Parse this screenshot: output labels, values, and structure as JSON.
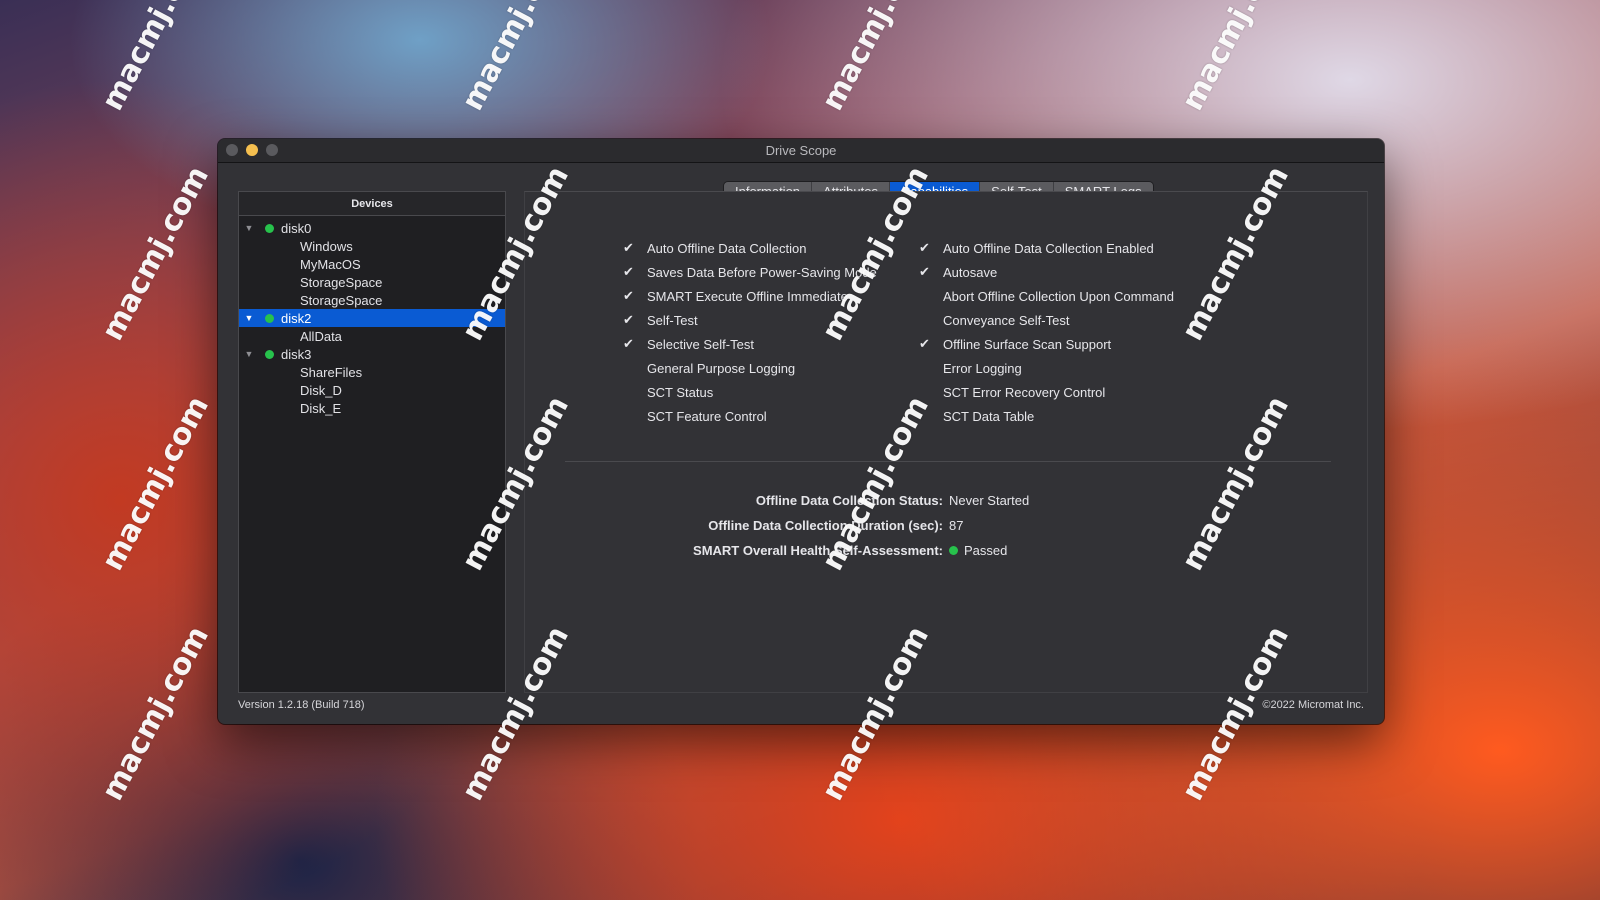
{
  "window": {
    "title": "Drive Scope",
    "traffic_lights": [
      "close",
      "minimize",
      "maximize"
    ]
  },
  "sidebar": {
    "header": "Devices",
    "items": [
      {
        "label": "disk0",
        "level": 0,
        "expanded": true,
        "status_color": "#27c24c",
        "selected": false
      },
      {
        "label": "Windows",
        "level": 1
      },
      {
        "label": "MyMacOS",
        "level": 1
      },
      {
        "label": "StorageSpace",
        "level": 1
      },
      {
        "label": "StorageSpace",
        "level": 1
      },
      {
        "label": "disk2",
        "level": 0,
        "expanded": true,
        "status_color": "#27c24c",
        "selected": true
      },
      {
        "label": "AllData",
        "level": 1
      },
      {
        "label": "disk3",
        "level": 0,
        "expanded": true,
        "status_color": "#27c24c",
        "selected": false
      },
      {
        "label": "ShareFiles",
        "level": 1
      },
      {
        "label": "Disk_D",
        "level": 1
      },
      {
        "label": "Disk_E",
        "level": 1
      }
    ]
  },
  "tabs": [
    {
      "label": "Information",
      "active": false
    },
    {
      "label": "Attributes",
      "active": false
    },
    {
      "label": "Capabilities",
      "active": true
    },
    {
      "label": "Self-Test",
      "active": false
    },
    {
      "label": "SMART Logs",
      "active": false
    }
  ],
  "capabilities": {
    "left": [
      {
        "label": "Auto Offline Data Collection",
        "checked": true
      },
      {
        "label": "Saves Data Before Power-Saving Mode",
        "checked": true
      },
      {
        "label": "SMART Execute Offline Immediate",
        "checked": true
      },
      {
        "label": "Self-Test",
        "checked": true
      },
      {
        "label": "Selective Self-Test",
        "checked": true
      },
      {
        "label": "General Purpose Logging",
        "checked": false
      },
      {
        "label": "SCT Status",
        "checked": false
      },
      {
        "label": "SCT Feature Control",
        "checked": false
      }
    ],
    "right": [
      {
        "label": "Auto Offline Data Collection Enabled",
        "checked": true
      },
      {
        "label": "Autosave",
        "checked": true
      },
      {
        "label": "Abort Offline Collection Upon Command",
        "checked": false
      },
      {
        "label": "Conveyance Self-Test",
        "checked": false
      },
      {
        "label": "Offline Surface Scan Support",
        "checked": true
      },
      {
        "label": "Error Logging",
        "checked": false
      },
      {
        "label": "SCT Error Recovery Control",
        "checked": false
      },
      {
        "label": "SCT Data Table",
        "checked": false
      }
    ],
    "check_glyph": "✔"
  },
  "status": [
    {
      "label": "Offline Data Collection Status:",
      "value": "Never Started"
    },
    {
      "label": "Offline Data Collection Duration (sec):",
      "value": "87"
    },
    {
      "label": "SMART Overall Health Self-Assessment:",
      "value": "Passed",
      "indicator_color": "#27c24c"
    }
  ],
  "footer": {
    "version": "Version 1.2.18 (Build 718)",
    "copyright": "©2022 Micromat Inc."
  },
  "watermark": "macmj.com",
  "colors": {
    "accent": "#0a5bd3",
    "status_ok": "#27c24c",
    "minimize": "#f5bf4f"
  }
}
